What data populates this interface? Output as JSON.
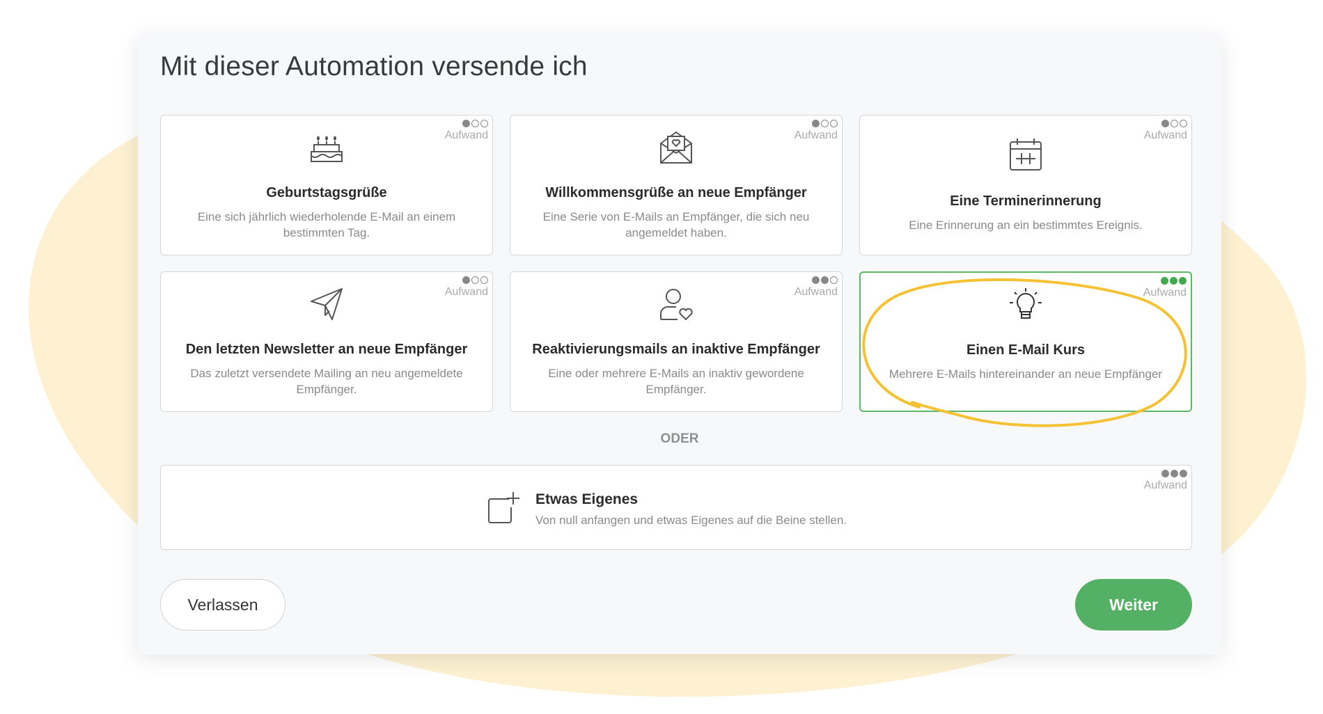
{
  "page": {
    "title": "Mit dieser Automation versende ich",
    "effort_label": "Aufwand",
    "or_label": "ODER"
  },
  "colors": {
    "accent_green": "#54b064",
    "highlight_yellow": "#f5c234",
    "background_blob": "#fdf1d2"
  },
  "cards": [
    {
      "title": "Geburtstagsgrüße",
      "description": "Eine sich jährlich wiederholende E-Mail an einem bestimmten Tag.",
      "effort": 1,
      "icon": "birthday-cake-icon"
    },
    {
      "title": "Willkommensgrüße an neue Empfänger",
      "description": "Eine Serie von E-Mails an Empfänger, die sich neu angemeldet haben.",
      "effort": 1,
      "icon": "envelope-heart-icon"
    },
    {
      "title": "Eine Terminerinnerung",
      "description": "Eine Erinnerung an ein bestimmtes Ereignis.",
      "effort": 1,
      "icon": "calendar-icon"
    },
    {
      "title": "Den letzten Newsletter an neue Empfänger",
      "description": "Das zuletzt versendete Mailing an neu angemeldete Empfänger.",
      "effort": 1,
      "icon": "paper-plane-icon"
    },
    {
      "title": "Reaktivierungsmails an inaktive Empfänger",
      "description": "Eine oder mehrere E-Mails an inaktiv gewordene Empfänger.",
      "effort": 2,
      "icon": "user-heart-icon"
    },
    {
      "title": "Einen E-Mail Kurs",
      "description": "Mehrere E-Mails hintereinander an neue Empfänger",
      "effort": 3,
      "icon": "lightbulb-icon",
      "selected": true
    }
  ],
  "custom": {
    "title": "Etwas Eigenes",
    "description": "Von null anfangen und etwas Eigenes auf die Beine stellen.",
    "effort": 3,
    "icon": "add-square-icon"
  },
  "buttons": {
    "leave": "Verlassen",
    "next": "Weiter"
  }
}
